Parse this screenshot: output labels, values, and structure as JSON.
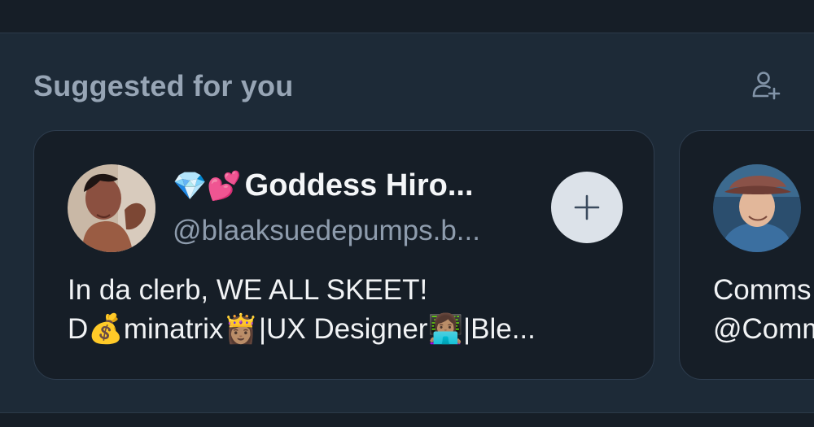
{
  "section": {
    "title": "Suggested for you",
    "action_icon": "add-user-icon"
  },
  "cards": [
    {
      "emoji_prefix": "💎💕",
      "display_name": "Goddess Hiro...",
      "handle": "@blaaksuedepumps.b...",
      "bio_line_1": "In da clerb, WE ALL SKEET!",
      "bio_line_2": "D💰minatrix👸🏽|UX Designer👩🏽‍💻|Ble...",
      "follow_icon": "plus-icon"
    },
    {
      "display_name_partial": "Comms",
      "handle_partial": "@Comm"
    }
  ],
  "colors": {
    "page_bg": "#161e27",
    "section_bg": "#1d2a37",
    "card_bg": "#161e27",
    "title": "#97a5b5",
    "handle": "#8e9cad",
    "follow_button_bg": "#dce2e9"
  }
}
